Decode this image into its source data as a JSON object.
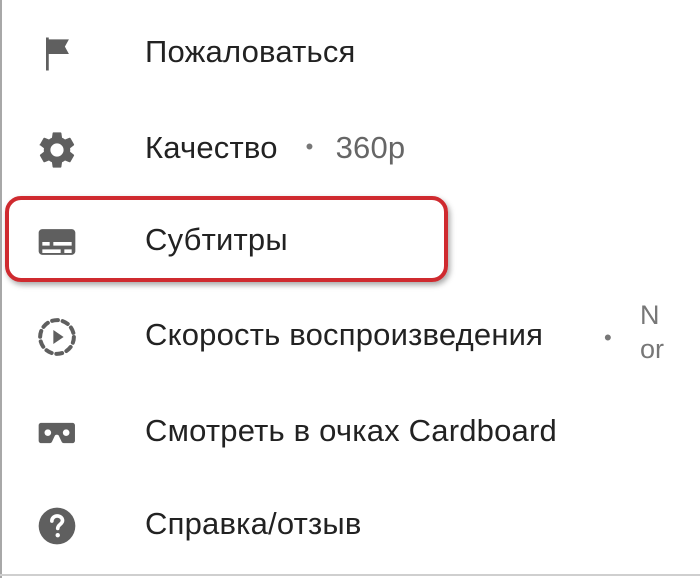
{
  "menu": {
    "items": [
      {
        "label": "Пожаловаться",
        "icon": "flag-icon"
      },
      {
        "label": "Качество",
        "icon": "gear-icon",
        "value": "360p"
      },
      {
        "label": "Субтитры",
        "icon": "subtitles-icon",
        "highlighted": true
      },
      {
        "label": "Скорость воспроизведения",
        "icon": "playback-speed-icon",
        "value_lines": [
          "N",
          "or"
        ]
      },
      {
        "label": "Смотреть в очках Cardboard",
        "icon": "cardboard-vr-icon"
      },
      {
        "label": "Справка/отзыв",
        "icon": "help-icon"
      }
    ],
    "separator": "•"
  },
  "colors": {
    "icon": "#5f5f5f",
    "text": "#222222",
    "secondary_text": "#666666",
    "highlight_border": "#cf2a2f"
  }
}
